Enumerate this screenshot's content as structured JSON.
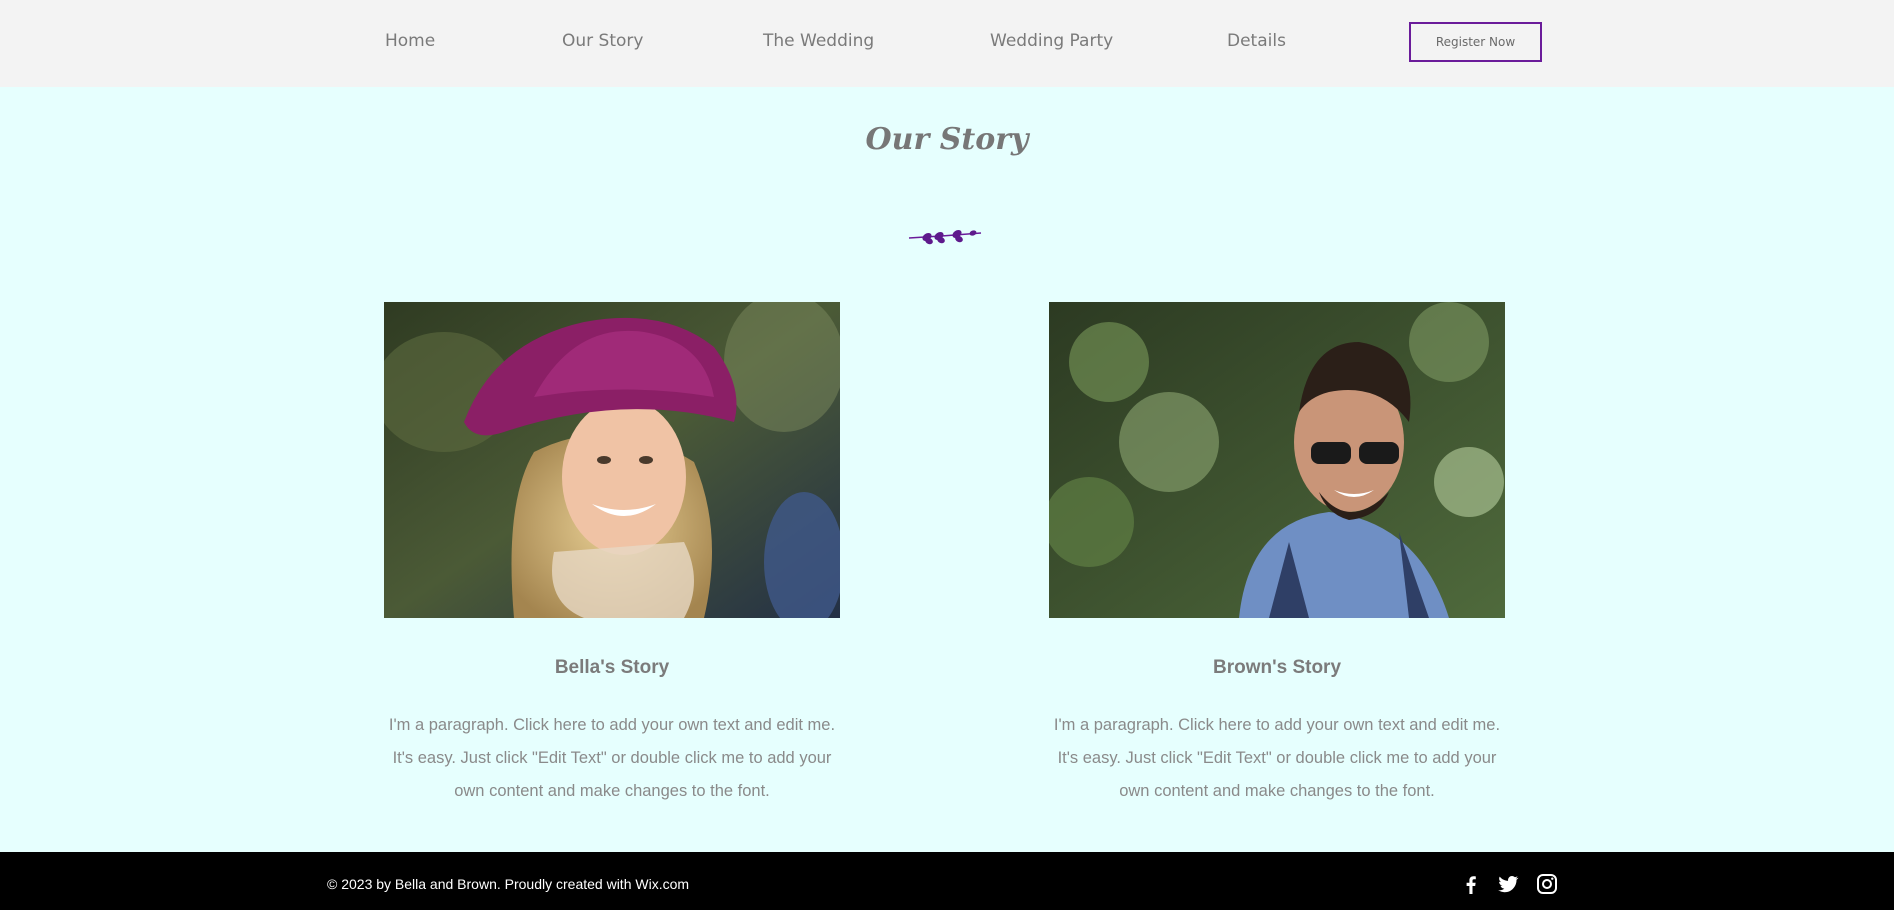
{
  "header": {
    "nav": [
      "Home",
      "Our Story",
      "The Wedding",
      "Wedding Party",
      "Details"
    ],
    "register_label": "Register Now"
  },
  "section": {
    "title": "Our Story"
  },
  "stories": [
    {
      "title": "Bella's Story",
      "body": "I'm a paragraph. Click here to add your own text and edit me. It's easy. Just click \"Edit Text\" or double click me to add your own content and make changes to the font."
    },
    {
      "title": "Brown's Story",
      "body": "I'm a paragraph. Click here to add your own text and edit me. It's easy. Just click \"Edit Text\" or double click me to add your own content and make changes to the font."
    }
  ],
  "footer": {
    "copyright": "© 2023 by Bella and Brown. Proudly created with Wix.com",
    "social": [
      "facebook-icon",
      "twitter-icon",
      "instagram-icon"
    ]
  },
  "colors": {
    "page_bg": "#e6fffe",
    "header_bg": "#f3f3f3",
    "accent": "#6a1b9a",
    "footer_bg": "#000000"
  }
}
